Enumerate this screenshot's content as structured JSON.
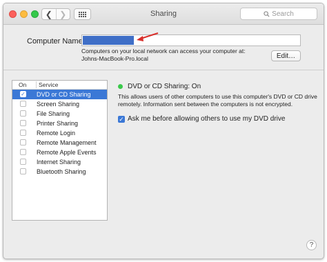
{
  "window": {
    "title": "Sharing"
  },
  "toolbar": {
    "back_glyph": "❮",
    "forward_glyph": "❯",
    "search_placeholder": "Search"
  },
  "computer_name": {
    "label": "Computer Name:",
    "selection_color": "#3f6fc7",
    "description_line1": "Computers on your local network can access your computer at:",
    "description_line2": "Johns-MacBook-Pro.local",
    "edit_button": "Edit…"
  },
  "services": {
    "header_on": "On",
    "header_service": "Service",
    "selected_color": "#3b78d6",
    "items": [
      {
        "label": "DVD or CD Sharing",
        "checked": true,
        "selected": true
      },
      {
        "label": "Screen Sharing",
        "checked": false,
        "selected": false
      },
      {
        "label": "File Sharing",
        "checked": false,
        "selected": false
      },
      {
        "label": "Printer Sharing",
        "checked": false,
        "selected": false
      },
      {
        "label": "Remote Login",
        "checked": false,
        "selected": false
      },
      {
        "label": "Remote Management",
        "checked": false,
        "selected": false
      },
      {
        "label": "Remote Apple Events",
        "checked": false,
        "selected": false
      },
      {
        "label": "Internet Sharing",
        "checked": false,
        "selected": false
      },
      {
        "label": "Bluetooth Sharing",
        "checked": false,
        "selected": false
      }
    ]
  },
  "detail": {
    "status": "DVD or CD Sharing: On",
    "status_color": "#3ac94a",
    "description_line1": "This allows users of other computers to use this computer's DVD or CD drive",
    "description_line2": "remotely. Information sent between the computers is not encrypted.",
    "ask_checkbox_checked": true,
    "ask_label": "Ask me before allowing others to use my DVD drive"
  },
  "annotation": {
    "arrow_color": "#d9302c"
  },
  "help_glyph": "?"
}
